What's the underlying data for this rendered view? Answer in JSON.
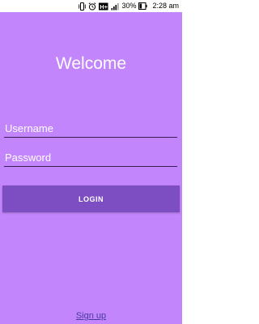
{
  "status_bar": {
    "battery_percent": "30%",
    "time": "2:28 am",
    "icons": [
      "vibrate-icon",
      "alarm-icon",
      "h-plus-icon",
      "signal-icon",
      "battery-icon"
    ]
  },
  "screen": {
    "background_color": "#c285fb",
    "title": "Welcome"
  },
  "form": {
    "username_placeholder": "Username",
    "username_value": "",
    "password_placeholder": "Password",
    "password_value": "",
    "login_label": "LOGIN",
    "login_color": "#7d4ec2"
  },
  "signup_label": "Sign up"
}
